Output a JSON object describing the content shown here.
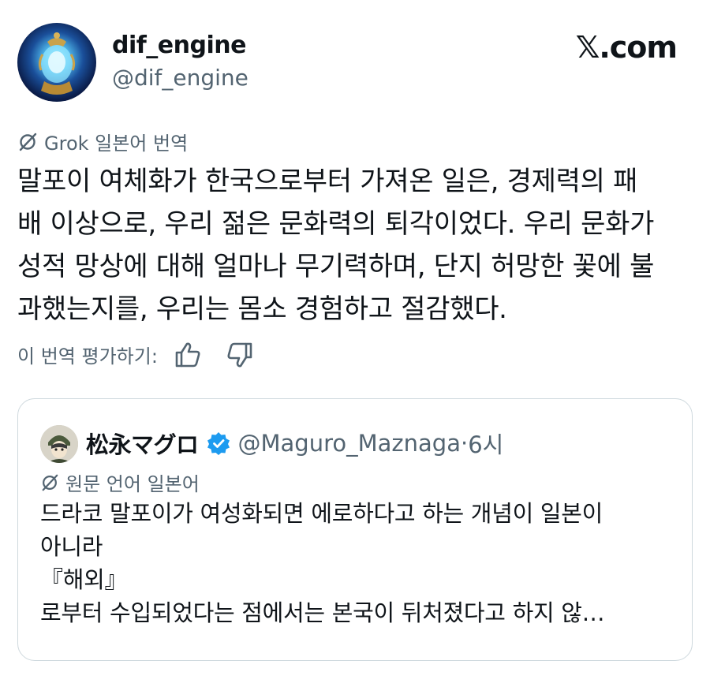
{
  "author": {
    "display_name": "dif_engine",
    "handle": "@dif_engine"
  },
  "site_logo": {
    "x": "𝕏",
    "text": ".com"
  },
  "translation_label": "Grok 일본어 번역",
  "tweet_text": "말포이 여체화가 한국으로부터 가져온 일은, 경제력의 패\n배 이상으로, 우리 젊은 문화력의 퇴각이었다. 우리 문화가\n성적 망상에 대해 얼마나 무기력하며, 단지 허망한 꽃에 불\n과했는지를, 우리는 몸소 경험하고 절감했다.",
  "rate_translation_label": "이 번역 평가하기:",
  "icons": {
    "grok": "grok-slash-icon",
    "thumbs_up": "thumbs-up-icon",
    "thumbs_down": "thumbs-down-icon",
    "verified": "verified-badge-icon"
  },
  "quote": {
    "display_name": "松永マグロ",
    "handle": "@Maguro_Maznaga",
    "separator": "·",
    "time": "6시",
    "original_language_label": "원문 언어 일본어",
    "text": "드라코 말포이가 여성화되면 에로하다고 하는 개념이 일본이\n아니라\n『해외』\n로부터 수입되었다는 점에서는 본국이 뒤처졌다고 하지 않…"
  },
  "colors": {
    "text": "#0f1419",
    "secondary": "#536471",
    "verified_blue": "#1d9bf0",
    "border": "#cfd9de"
  }
}
